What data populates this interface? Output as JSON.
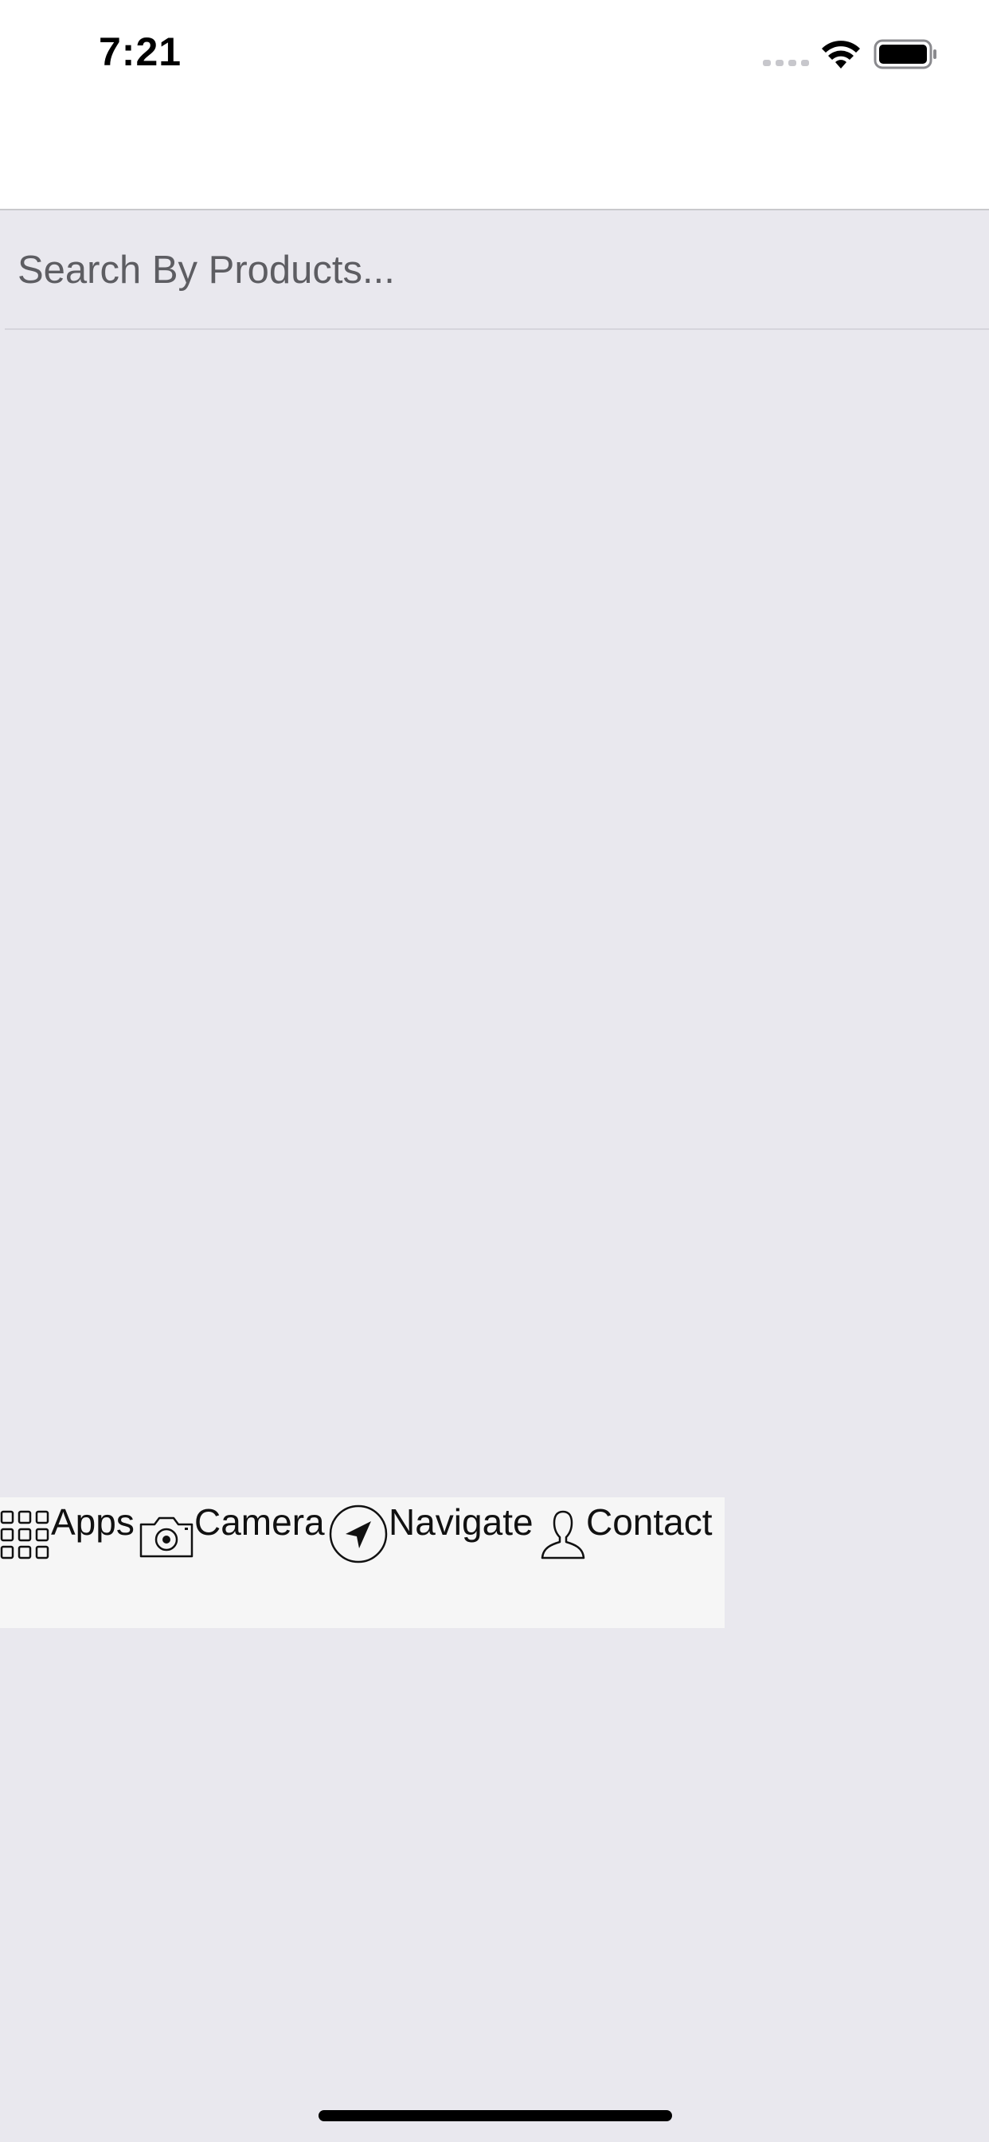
{
  "status_bar": {
    "time": "7:21",
    "icons": [
      "cellular-signal-icon",
      "wifi-icon",
      "battery-icon"
    ]
  },
  "search": {
    "placeholder": "Search By Products..."
  },
  "tabbar": {
    "tabs": [
      {
        "label": "Apps",
        "icon": "apps-grid-icon"
      },
      {
        "label": "Camera",
        "icon": "camera-icon"
      },
      {
        "label": "Navigate",
        "icon": "navigate-arrow-icon"
      },
      {
        "label": "Contact",
        "icon": "contact-person-icon"
      }
    ]
  },
  "colors": {
    "background": "#e9e8ee",
    "header": "#ffffff",
    "tabbar": "#f6f6f6",
    "placeholder_text": "#5d5d62"
  }
}
